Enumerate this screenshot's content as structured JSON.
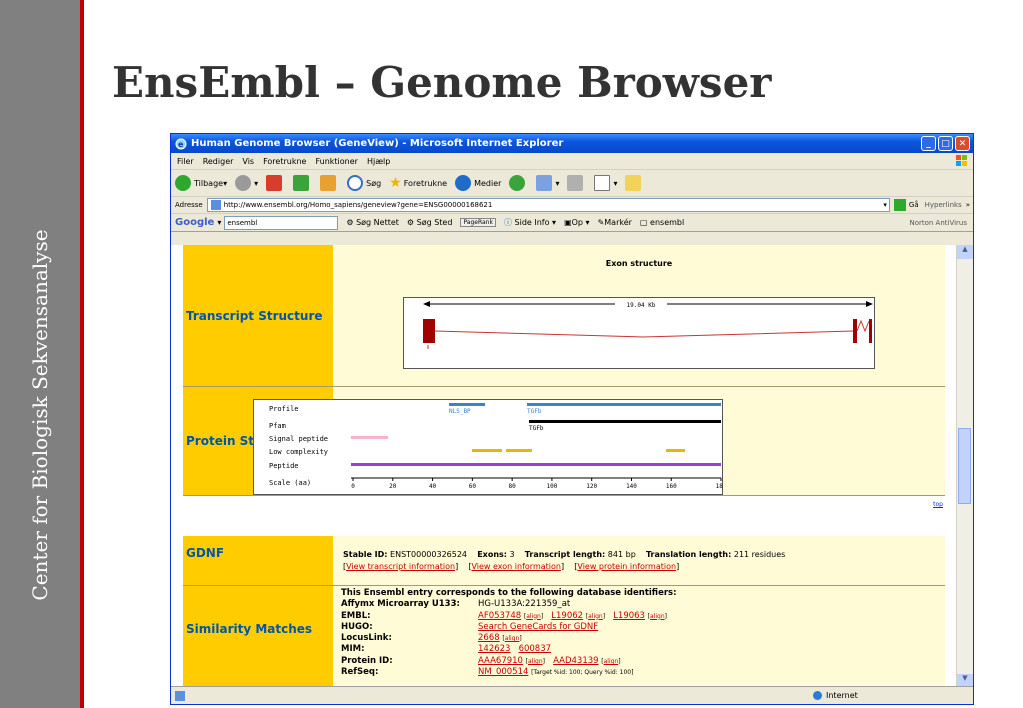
{
  "slide": {
    "title": "EnsEmbl – Genome Browser",
    "sidebar_text": "Center for Biologisk Sekvensanalyse"
  },
  "window": {
    "title": "Human Genome Browser (GeneView) - Microsoft Internet Explorer",
    "menu": [
      "Filer",
      "Rediger",
      "Vis",
      "Foretrukne",
      "Funktioner",
      "Hjælp"
    ],
    "toolbar": {
      "back": "Tilbage",
      "search": "Søg",
      "favorites": "Foretrukne",
      "media": "Medier"
    },
    "address": {
      "label": "Adresse",
      "url": "http://www.ensembl.org/Homo_sapiens/geneview?gene=ENSG00000168621",
      "go": "Gå",
      "links": "Hyperlinks"
    },
    "google": {
      "logo": "Google",
      "query": "ensembl",
      "buttons": [
        "Søg Nettet",
        "Søg Sted",
        "Side Info",
        "Op",
        "Markér",
        "ensembl"
      ],
      "pagerank": "PageRank",
      "norton": "Norton AntiVirus"
    },
    "status": {
      "zone": "Internet"
    }
  },
  "page": {
    "transcript": {
      "label": "Transcript Structure",
      "heading": "Exon structure",
      "length": "19.04 Kb"
    },
    "protein": {
      "label": "Protein Structure",
      "tracks": [
        "Profile",
        "Pfam",
        "Signal peptide",
        "Low complexity",
        "Peptide",
        "Scale (aa)"
      ],
      "domains": {
        "nls": "NLS_BP",
        "tgfb_profile": "TGFb",
        "tgfb_pfam": "TGFb"
      },
      "scale": [
        "0",
        "20",
        "40",
        "60",
        "80",
        "100",
        "120",
        "140",
        "160",
        "185"
      ],
      "top_link": "top"
    },
    "gdnf": {
      "label": "GDNF",
      "stable_id_label": "Stable ID:",
      "stable_id": "ENST00000326524",
      "exons_label": "Exons:",
      "exons": "3",
      "tlen_label": "Transcript length:",
      "tlen": "841 bp",
      "trlen_label": "Translation length:",
      "trlen": "211 residues",
      "links": [
        "View transcript information",
        "View exon information",
        "View protein information"
      ]
    },
    "similarity": {
      "label": "Similarity Matches",
      "intro": "This Ensembl entry corresponds to the following database identifiers:",
      "affymetrix_label": "Affymx Microarray U133:",
      "affymetrix": "HG-U133A:221359_at",
      "embl_label": "EMBL:",
      "embl": [
        "AF053748",
        "L19062",
        "L19063"
      ],
      "align": "align",
      "hugo_label": "HUGO:",
      "hugo": "Search GeneCards for GDNF",
      "locus_label": "LocusLink:",
      "locus": "2668",
      "mim_label": "MIM:",
      "mim": [
        "142623",
        "600837"
      ],
      "protein_label": "Protein ID:",
      "protein": [
        "AAA67910",
        "AAD43139"
      ],
      "refseq_label": "RefSeq:",
      "refseq": "NM_000514",
      "refseq_note": "[Target %id: 100; Query %id: 100]"
    }
  }
}
